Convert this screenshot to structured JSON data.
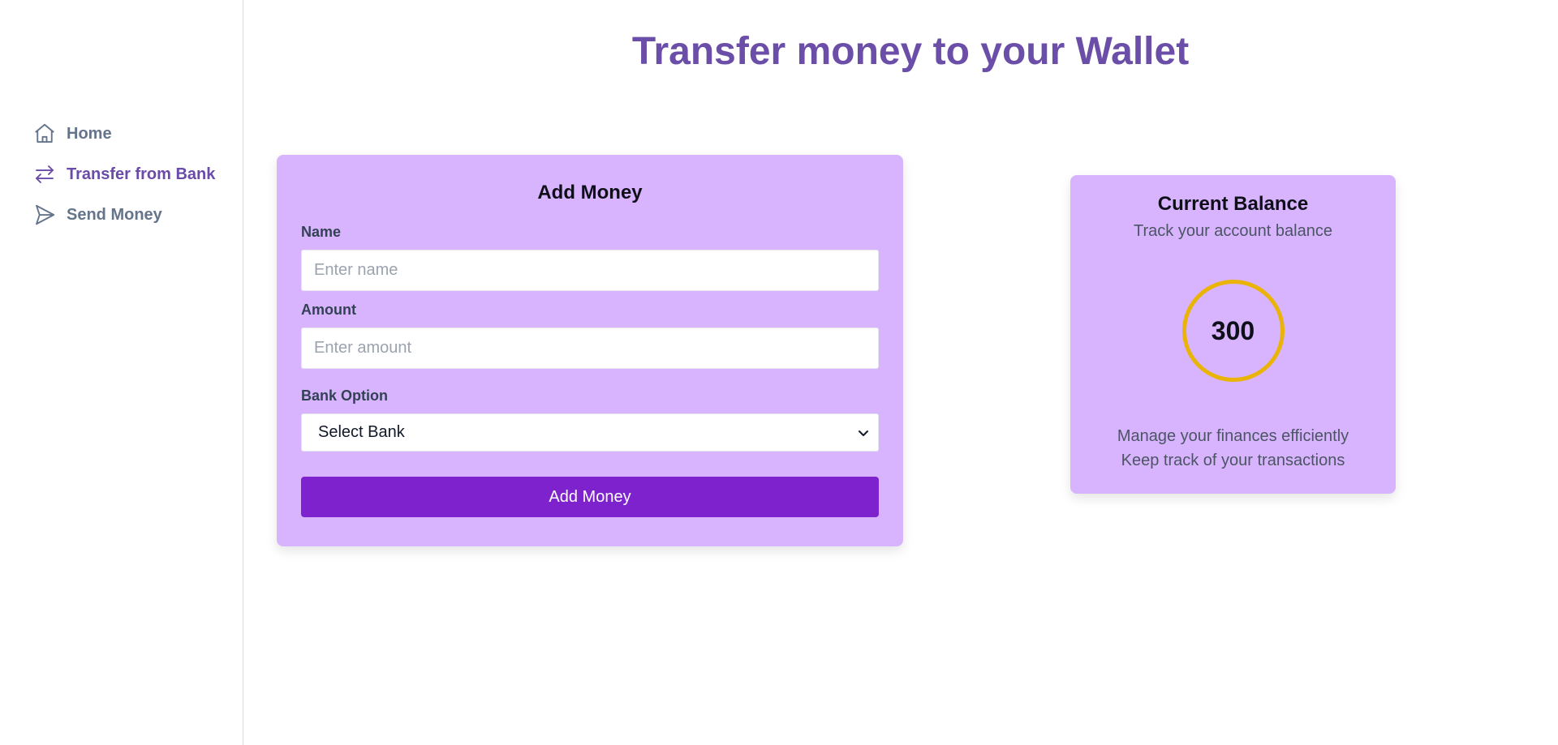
{
  "sidebar": {
    "items": [
      {
        "label": "Home",
        "icon": "home-icon",
        "active": false
      },
      {
        "label": "Transfer from Bank",
        "icon": "transfer-arrows-icon",
        "active": true
      },
      {
        "label": "Send Money",
        "icon": "send-icon",
        "active": false
      }
    ]
  },
  "header": {
    "title": "Transfer money to your Wallet"
  },
  "add_money": {
    "title": "Add Money",
    "name_label": "Name",
    "name_placeholder": "Enter name",
    "name_value": "",
    "amount_label": "Amount",
    "amount_placeholder": "Enter amount",
    "amount_value": "",
    "bank_label": "Bank Option",
    "bank_selected": "Select Bank",
    "submit_label": "Add Money"
  },
  "balance": {
    "title": "Current Balance",
    "subtitle": "Track your account balance",
    "amount": "300",
    "note_line1": "Manage your finances efficiently",
    "note_line2": "Keep track of your transactions"
  },
  "colors": {
    "accent": "#6b4ea8",
    "card_bg": "#d8b4fe",
    "button_bg": "#7e22ce",
    "ring": "#eab308",
    "nav_inactive": "#64748b"
  }
}
